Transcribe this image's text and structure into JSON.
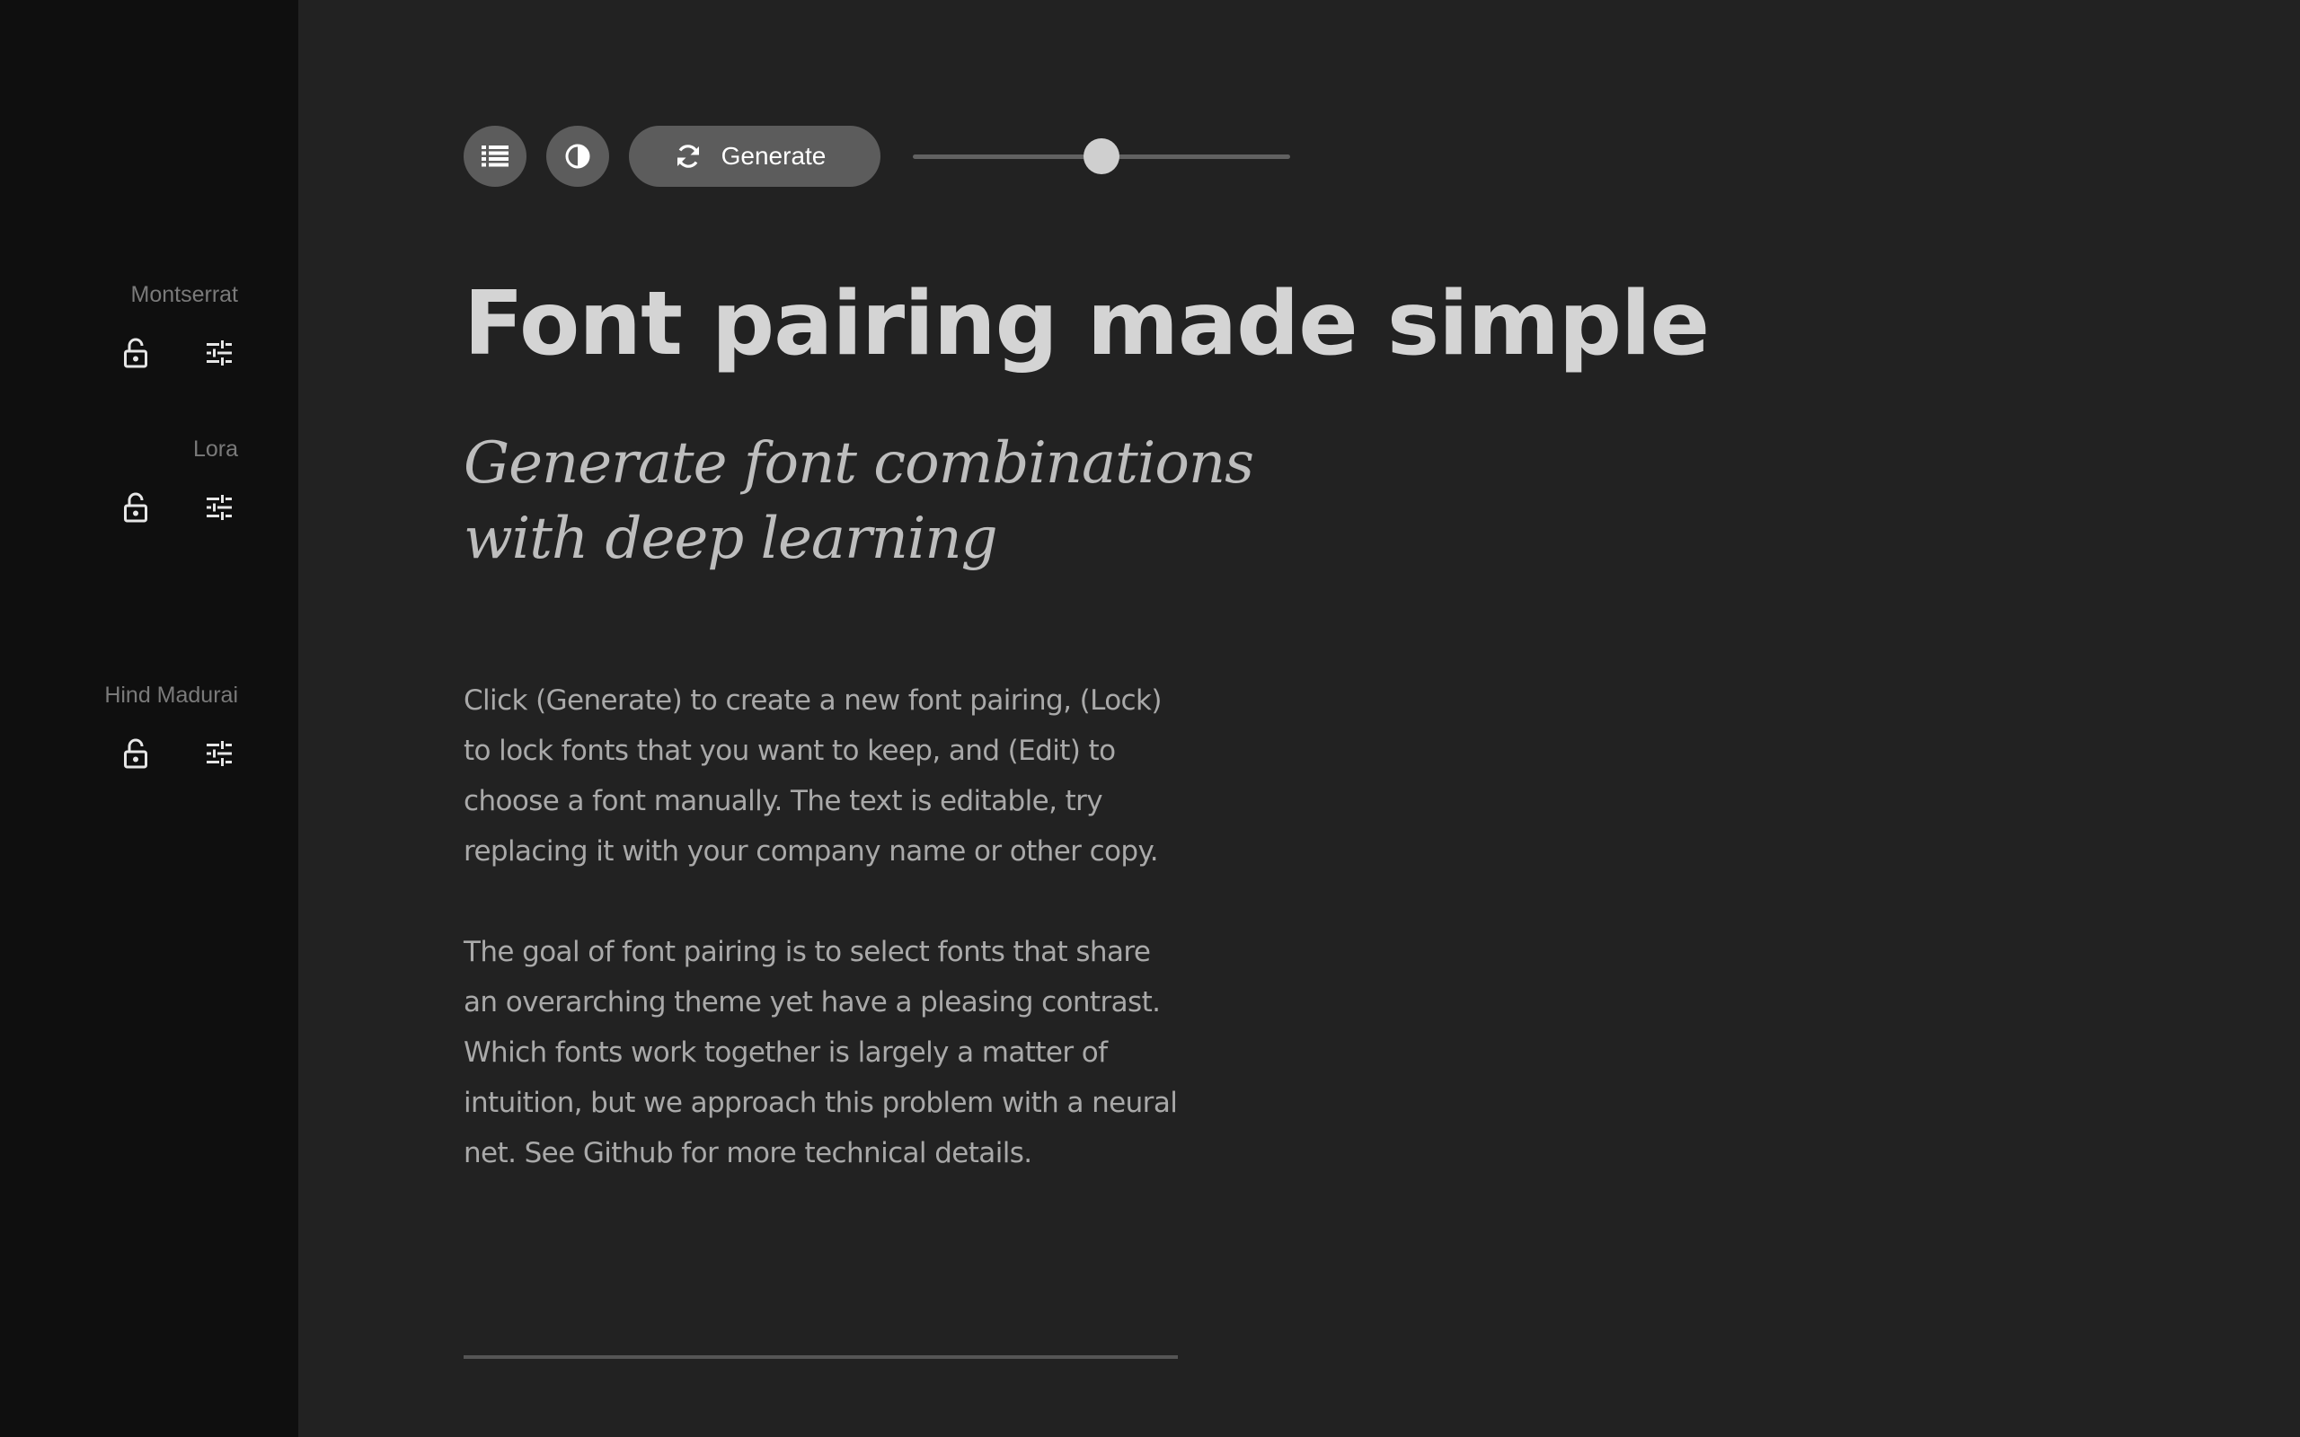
{
  "sidebar": {
    "fonts": [
      {
        "name": "Montserrat"
      },
      {
        "name": "Lora"
      },
      {
        "name": "Hind Madurai"
      }
    ],
    "icons": {
      "lock": "lock-open-icon",
      "edit": "tune-sliders-icon"
    }
  },
  "toolbar": {
    "list_icon": "list-icon",
    "contrast_icon": "contrast-icon",
    "generate_icon": "refresh-icon",
    "generate_label": "Generate",
    "slider_level": 0.5
  },
  "content": {
    "headline": "Font pairing made simple",
    "subheadline": [
      "Generate font combinations",
      "with deep learning"
    ],
    "paragraph1": [
      "Click (Generate) to create a new font pairing, (Lock)",
      "to lock fonts that you want to keep, and (Edit) to",
      "choose a font manually. The text is editable, try",
      "replacing it with your company name or other copy."
    ],
    "paragraph2": [
      "The goal of font pairing is to select fonts that share",
      "an overarching theme yet have a pleasing contrast.",
      "Which fonts work together is largely a matter of",
      "intuition, but we approach this problem with a neural",
      "net. See Github for more technical details."
    ]
  },
  "colors": {
    "sidebar_bg": "#0f0f0f",
    "main_bg": "#222222",
    "button_bg": "#5c5c5c",
    "headline": "#d4d4d4",
    "body": "#a9a9a9"
  }
}
